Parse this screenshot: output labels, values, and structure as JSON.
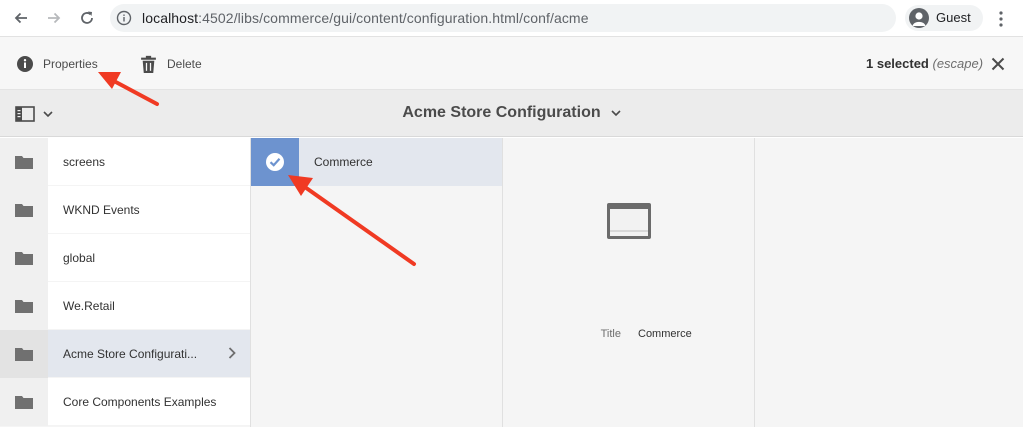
{
  "browser": {
    "url_host": "localhost",
    "url_path": ":4502/libs/commerce/gui/content/configuration.html/conf/acme",
    "profile_label": "Guest"
  },
  "actionbar": {
    "properties_label": "Properties",
    "delete_label": "Delete",
    "selected_count": "1 selected",
    "escape_hint": "(escape)"
  },
  "titlebar": {
    "title": "Acme Store Configuration"
  },
  "column1": {
    "items": [
      {
        "label": "screens"
      },
      {
        "label": "WKND Events"
      },
      {
        "label": "global"
      },
      {
        "label": "We.Retail"
      },
      {
        "label": "Acme Store Configurati..."
      },
      {
        "label": "Core Components Examples"
      }
    ]
  },
  "column2": {
    "items": [
      {
        "label": "Commerce"
      }
    ]
  },
  "preview": {
    "title_key": "Title",
    "title_value": "Commerce"
  },
  "colors": {
    "selection_blue": "#6d93cf",
    "annotation_red": "#f03a23"
  },
  "icons": [
    "back-icon",
    "forward-icon",
    "reload-icon",
    "info-icon",
    "avatar-icon",
    "more-icon",
    "info-circle-icon",
    "trash-icon",
    "close-icon",
    "rail-icon",
    "chevron-down-icon",
    "folder-icon",
    "chevron-right-icon",
    "checkmark-icon",
    "page-icon"
  ]
}
